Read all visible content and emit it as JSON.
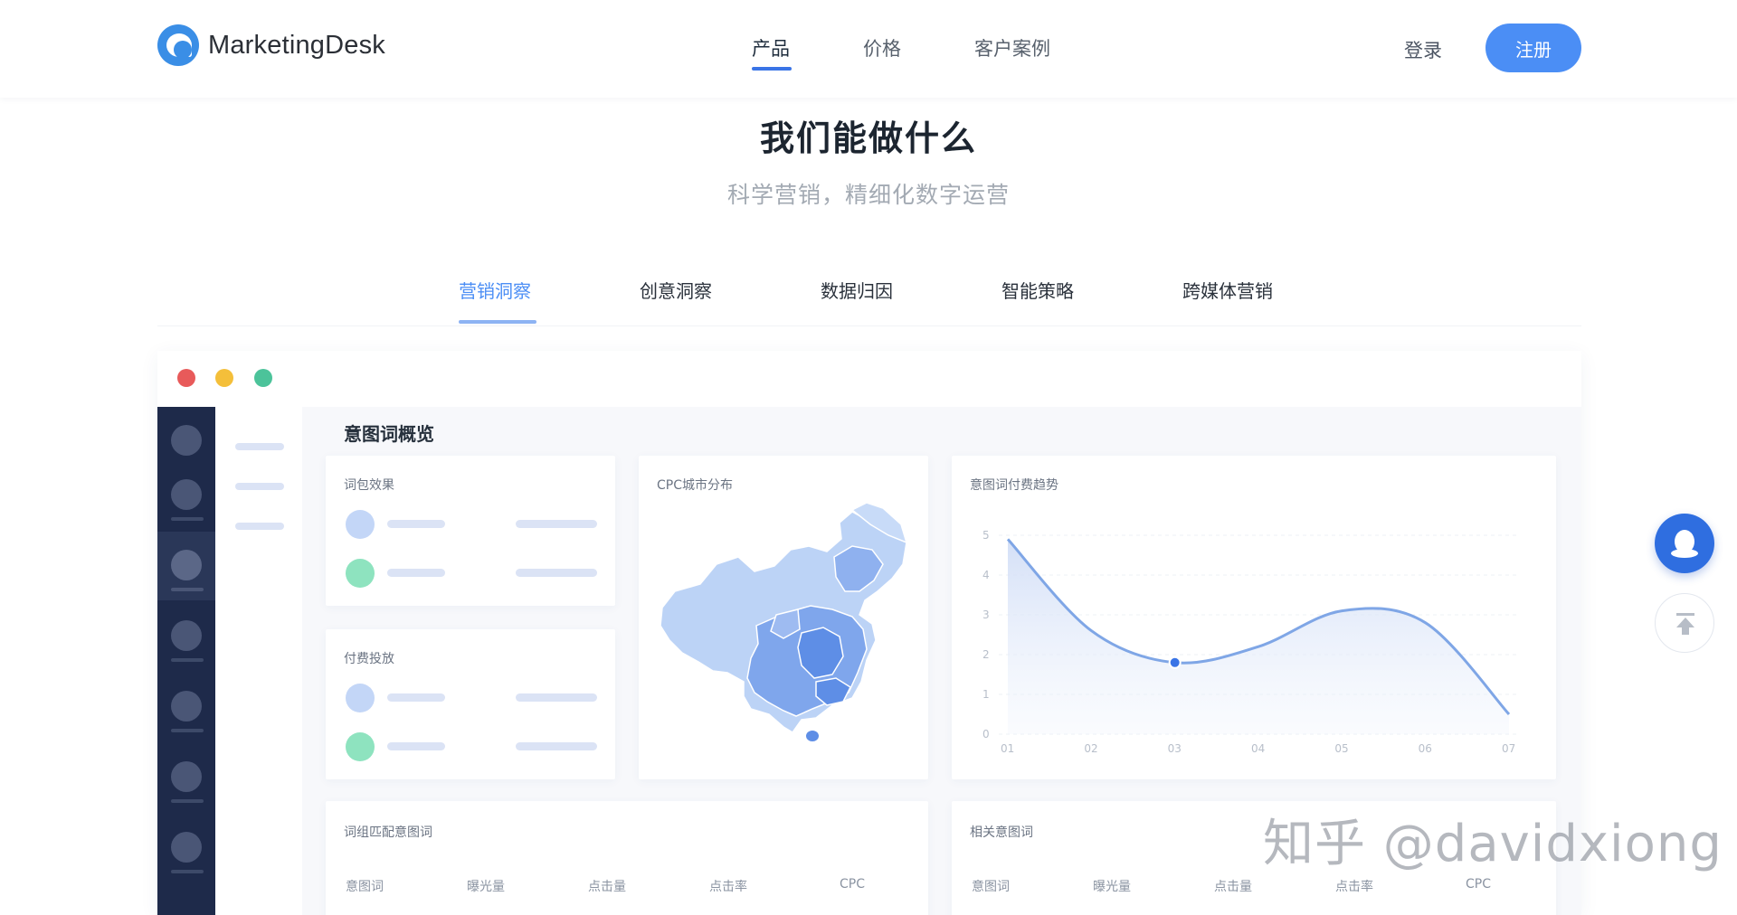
{
  "header": {
    "logo_text": "MarketingDesk",
    "nav": [
      {
        "label": "产品",
        "active": true
      },
      {
        "label": "价格",
        "active": false
      },
      {
        "label": "客户案例",
        "active": false
      }
    ],
    "login_label": "登录",
    "signup_label": "注册"
  },
  "hero": {
    "title": "我们能做什么",
    "subtitle": "科学营销，精细化数字运营"
  },
  "tabs": [
    {
      "label": "营销洞察",
      "active": true
    },
    {
      "label": "创意洞察",
      "active": false
    },
    {
      "label": "数据归因",
      "active": false
    },
    {
      "label": "智能策略",
      "active": false
    },
    {
      "label": "跨媒体营销",
      "active": false
    }
  ],
  "dashboard": {
    "section_title": "意图词概览",
    "card_word_effect": "词包效果",
    "card_paid": "付费投放",
    "card_map": "CPC城市分布",
    "card_trend": "意图词付费趋势",
    "card_match": "词组匹配意图词",
    "card_related": "相关意图词",
    "table_columns": [
      "意图词",
      "曝光量",
      "点击量",
      "点击率",
      "CPC"
    ]
  },
  "chart_data": {
    "type": "line",
    "title": "意图词付费趋势",
    "x": [
      "01",
      "02",
      "03",
      "04",
      "05",
      "06",
      "07"
    ],
    "y_ticks": [
      "0",
      "1",
      "2",
      "3",
      "4",
      "5"
    ],
    "ylim": [
      0,
      5
    ],
    "series": [
      {
        "values": [
          4.9,
          2.6,
          1.8,
          2.2,
          3.1,
          2.8,
          0.5
        ]
      }
    ],
    "highlight_point": {
      "x": "03",
      "y": 1.8
    },
    "grid": true
  },
  "colors": {
    "accent": "#4b8ef5",
    "sidebar_dark": "#1e2a4a",
    "dot_red": "#e85a5a",
    "dot_yellow": "#f4bf3a",
    "dot_green": "#4cc39a",
    "circle_blue": "#c3d6f7",
    "circle_green": "#8ee3bf"
  },
  "icons": {
    "qq": "qq-penguin-icon",
    "back_to_top": "back-to-top-icon"
  },
  "watermark": "知乎 @davidxiong"
}
